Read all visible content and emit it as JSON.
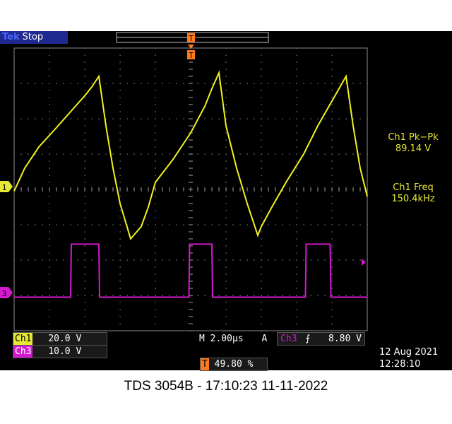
{
  "status": {
    "brand": "Tek",
    "acq_state": "Stop"
  },
  "measurements": [
    {
      "label": "Ch1 Pk−Pk",
      "value": "89.14 V"
    },
    {
      "label": "Ch1 Freq",
      "value": "150.4kHz"
    }
  ],
  "channels": [
    {
      "id": "1",
      "name": "Ch1",
      "scale": "20.0 V",
      "color": "#f2f21e"
    },
    {
      "id": "3",
      "name": "Ch3",
      "scale": "10.0 V",
      "color": "#d41ad0"
    }
  ],
  "timebase": {
    "prefix": "M",
    "value": "2.00µs"
  },
  "trigger": {
    "mode": "A",
    "source": "Ch3",
    "level": "8.80 V",
    "position": "49.80 %",
    "marker": "T"
  },
  "datetime": {
    "date": "12 Aug 2021",
    "time": "12:28:10"
  },
  "caption": "TDS 3054B - 17:10:23   11-11-2022",
  "chart_data": {
    "type": "line",
    "grid": true,
    "divisions": {
      "x": 10,
      "y": 8
    },
    "x_unit": "div",
    "y_unit": "div",
    "xlim": [
      0,
      10
    ],
    "ylim": [
      -4,
      4
    ],
    "series": [
      {
        "name": "Ch1",
        "x": [
          0.0,
          0.3,
          0.7,
          1.2,
          1.6,
          2.0,
          2.2,
          2.4,
          2.6,
          2.8,
          3.0,
          3.3,
          3.6,
          3.8,
          4.0,
          4.5,
          5.0,
          5.4,
          5.6,
          5.8,
          6.0,
          6.3,
          6.6,
          6.9,
          7.0,
          7.3,
          7.7,
          8.2,
          8.6,
          9.0,
          9.2,
          9.4,
          9.6,
          9.8,
          10.0
        ],
        "y": [
          -0.05,
          0.6,
          1.2,
          1.75,
          2.2,
          2.65,
          2.9,
          3.2,
          1.8,
          0.6,
          -0.4,
          -1.4,
          -1.05,
          -0.5,
          0.2,
          0.85,
          1.6,
          2.35,
          2.85,
          3.3,
          1.8,
          0.6,
          -0.4,
          -1.3,
          -1.05,
          -0.5,
          0.2,
          1.0,
          1.8,
          2.5,
          2.85,
          3.2,
          1.8,
          0.6,
          -0.2
        ]
      },
      {
        "name": "Ch3",
        "x": [
          0.0,
          1.6,
          1.62,
          2.4,
          2.42,
          4.95,
          4.97,
          5.6,
          5.62,
          8.25,
          8.27,
          8.95,
          8.97,
          10.0
        ],
        "y": [
          -3.05,
          -3.05,
          -1.55,
          -1.55,
          -3.05,
          -3.05,
          -1.55,
          -1.55,
          -3.05,
          -3.05,
          -1.55,
          -1.55,
          -3.05,
          -3.05
        ]
      }
    ]
  }
}
